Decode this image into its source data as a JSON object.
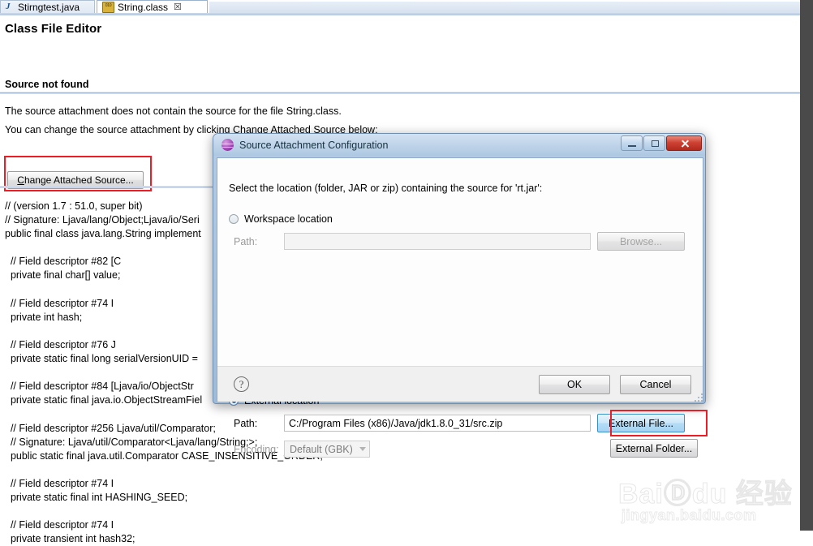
{
  "tabs": [
    {
      "label": "Stirngtest.java",
      "icon": "java-file-icon",
      "active": false,
      "closable": false
    },
    {
      "label": "String.class",
      "icon": "class-file-icon",
      "active": true,
      "closable": true,
      "close_glyph": "☒"
    }
  ],
  "editor": {
    "page_title": "Class File Editor",
    "section_title": "Source not found",
    "desc_line1": "The source attachment does not contain the source for the file String.class.",
    "desc_line2": "You can change the source attachment by clicking Change Attached Source below:",
    "change_button": {
      "prefix": "C",
      "rest": "hange Attached Source..."
    },
    "code_lines": [
      "// (version 1.7 : 51.0, super bit)",
      "// Signature: Ljava/lang/Object;Ljava/io/Seri",
      "public final class java.lang.String implement",
      "",
      "  // Field descriptor #82 [C",
      "  private final char[] value;",
      "",
      "  // Field descriptor #74 I",
      "  private int hash;",
      "",
      "  // Field descriptor #76 J",
      "  private static final long serialVersionUID =",
      "",
      "  // Field descriptor #84 [Ljava/io/ObjectStr",
      "  private static final java.io.ObjectStreamFiel",
      "",
      "  // Field descriptor #256 Ljava/util/Comparator;",
      "  // Signature: Ljava/util/Comparator<Ljava/lang/String;>;",
      "  public static final java.util.Comparator CASE_INSENSITIVE_ORDER;",
      "",
      "  // Field descriptor #74 I",
      "  private static final int HASHING_SEED;",
      "",
      "  // Field descriptor #74 I",
      "  private transient int hash32;"
    ]
  },
  "dialog": {
    "title": "Source Attachment Configuration",
    "icon": "eclipse-sphere-icon",
    "window_controls": [
      {
        "name": "minimize-button",
        "glyph": ""
      },
      {
        "name": "maximize-button",
        "glyph": ""
      },
      {
        "name": "close-button",
        "glyph": ""
      }
    ],
    "prompt": "Select the location (folder, JAR or zip) containing the source for 'rt.jar':",
    "workspace": {
      "radio_label": "Workspace location",
      "selected": false,
      "path_label": "Path:",
      "path_value": "",
      "browse_label": "Browse..."
    },
    "external": {
      "radio_label": "External location",
      "selected": true,
      "path_label": "Path:",
      "path_value": "C:/Program Files (x86)/Java/jdk1.8.0_31/src.zip",
      "external_file_label": "External File...",
      "external_folder_label": "External Folder...",
      "encoding_label": "Encoding:",
      "encoding_value": "Default (GBK)"
    },
    "footer": {
      "help_glyph": "?",
      "ok_label": "OK",
      "cancel_label": "Cancel"
    }
  },
  "watermark": {
    "main": "BaiⒹdu 经验",
    "sub": "jingyan.baidu.com"
  },
  "colors": {
    "highlight_red": "#ee1c25",
    "focus_blue": "#3c8fc4",
    "title_bar": "#bed3e9"
  }
}
